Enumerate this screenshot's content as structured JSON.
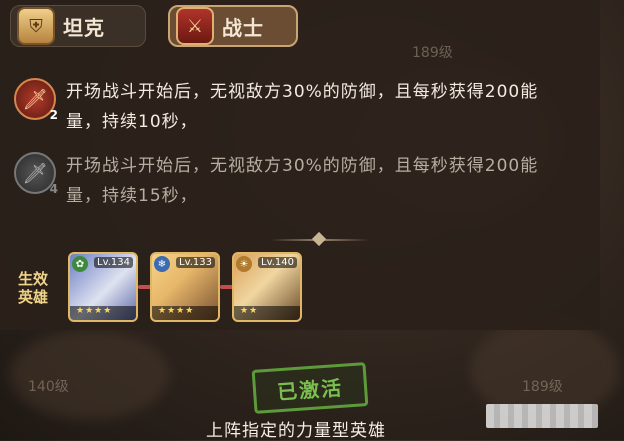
{
  "tabs": [
    {
      "label": "坦克",
      "icon": "shield-icon",
      "selected": false
    },
    {
      "label": "战士",
      "icon": "sword-icon",
      "selected": true
    }
  ],
  "skills": [
    {
      "level": "2",
      "icon": "sword-skill-icon",
      "active": true,
      "description": "开场战斗开始后，无视敌方30%的防御，且每秒获得200能量，持续10秒，"
    },
    {
      "level": "4",
      "icon": "sword-skill-icon",
      "active": false,
      "description": "开场战斗开始后，无视敌方30%的防御，且每秒获得200能量，持续15秒，"
    }
  ],
  "heroes_label": "生效英雄",
  "heroes": [
    {
      "level": "Lv.134",
      "stars": "★★★★",
      "faction_icon": "nature-icon"
    },
    {
      "level": "Lv.133",
      "stars": "★★★★",
      "faction_icon": "water-icon"
    },
    {
      "level": "Lv.140",
      "stars": "★★",
      "faction_icon": "light-icon"
    }
  ],
  "background_levels": [
    "189级",
    "140级",
    "189级"
  ],
  "status_stamp": "已激活",
  "footer": "上阵指定的力量型英雄"
}
